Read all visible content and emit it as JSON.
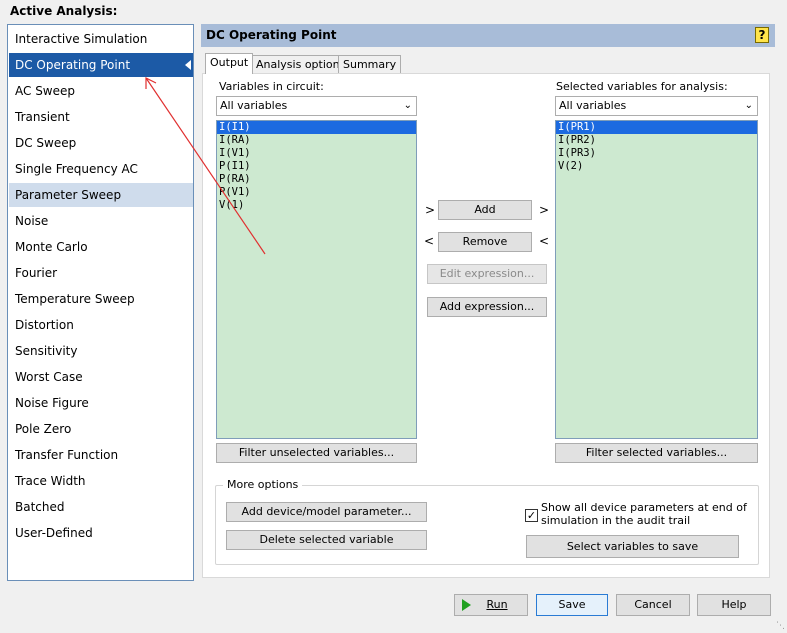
{
  "active_analysis_label": "Active Analysis:",
  "analyses": [
    "Interactive Simulation",
    "DC Operating Point",
    "AC Sweep",
    "Transient",
    "DC Sweep",
    "Single Frequency AC",
    "Parameter Sweep",
    "Noise",
    "Monte Carlo",
    "Fourier",
    "Temperature Sweep",
    "Distortion",
    "Sensitivity",
    "Worst Case",
    "Noise Figure",
    "Pole Zero",
    "Transfer Function",
    "Trace Width",
    "Batched",
    "User-Defined"
  ],
  "selected_analysis": "DC Operating Point",
  "panel_title": "DC Operating Point",
  "help_icon": "?",
  "tabs": [
    "Output",
    "Analysis options",
    "Summary"
  ],
  "left": {
    "label": "Variables in circuit:",
    "filter": "All variables",
    "variables": [
      "I(I1)",
      "I(RA)",
      "I(V1)",
      "P(I1)",
      "P(RA)",
      "P(V1)",
      "V(1)"
    ],
    "filter_button": "Filter unselected variables..."
  },
  "right": {
    "label": "Selected variables for analysis:",
    "filter": "All variables",
    "variables": [
      "I(PR1)",
      "I(PR2)",
      "I(PR3)",
      "V(2)"
    ],
    "filter_button": "Filter selected variables..."
  },
  "middle": {
    "add": "Add",
    "remove": "Remove",
    "edit_expression": "Edit expression...",
    "add_expression": "Add expression...",
    "gt": ">",
    "lt": "<"
  },
  "more_options": {
    "title": "More options",
    "add_param": "Add device/model parameter...",
    "delete_var": "Delete selected variable",
    "show_all_line1": "Show all device parameters at end of",
    "show_all_line2": "simulation in the audit trail",
    "show_all_checked": true,
    "select_vars": "Select variables to save"
  },
  "footer": {
    "run": "Run",
    "save": "Save",
    "cancel": "Cancel",
    "help": "Help"
  },
  "colors": {
    "selection_blue": "#1c5aa6",
    "list_green": "#cde9d0",
    "header_blue": "#a8bcd8",
    "annotation_red": "#e03030"
  }
}
